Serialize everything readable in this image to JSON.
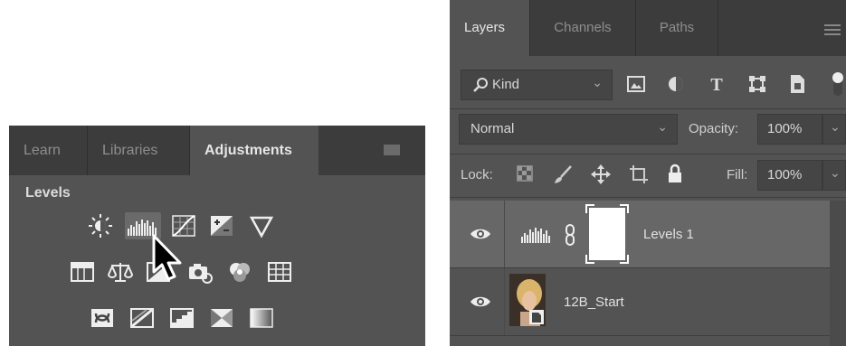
{
  "adjustments_panel": {
    "tabs": [
      {
        "label": "Learn"
      },
      {
        "label": "Libraries"
      },
      {
        "label": "Adjustments"
      }
    ],
    "section_title": "Levels",
    "icon_rows": [
      [
        "brightness-contrast-icon",
        "levels-icon",
        "curves-icon",
        "exposure-icon",
        "vibrance-icon"
      ],
      [
        "hue-saturation-icon",
        "color-balance-icon",
        "black-white-icon",
        "photo-filter-icon",
        "channel-mixer-icon",
        "color-lookup-icon"
      ],
      [
        "invert-icon",
        "posterize-icon",
        "threshold-icon",
        "selective-color-icon",
        "gradient-map-icon"
      ]
    ]
  },
  "layers_panel": {
    "tabs": [
      {
        "label": "Layers"
      },
      {
        "label": "Channels"
      },
      {
        "label": "Paths"
      }
    ],
    "filter": {
      "value": "Kind"
    },
    "blend_mode": {
      "value": "Normal"
    },
    "opacity": {
      "label": "Opacity:",
      "value": "100%"
    },
    "lock": {
      "label": "Lock:"
    },
    "fill": {
      "label": "Fill:",
      "value": "100%"
    },
    "layers": [
      {
        "name": "Levels 1",
        "selected": true
      },
      {
        "name": "12B_Start",
        "selected": false
      }
    ]
  },
  "colors": {
    "panel_bg": "#535353",
    "tabbar_bg": "#3c3c3c",
    "selected_layer_bg": "#676767",
    "field_bg": "#454545"
  }
}
